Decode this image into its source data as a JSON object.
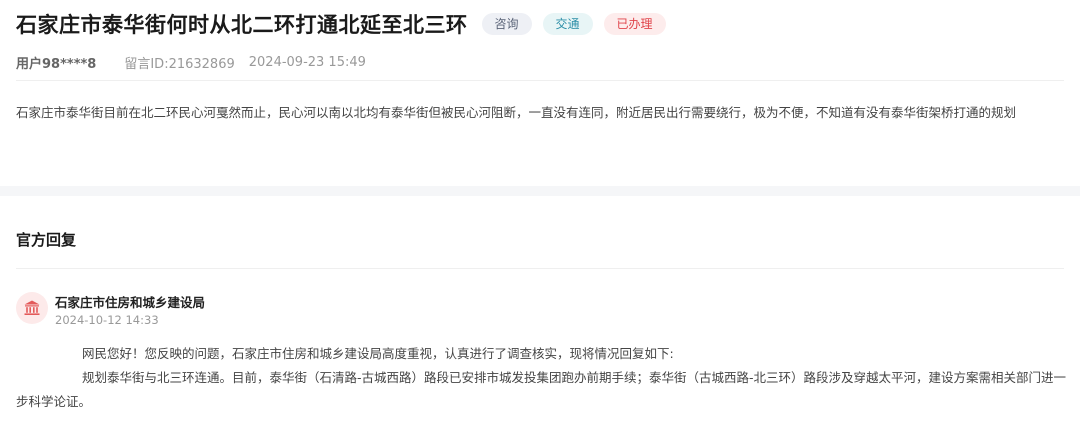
{
  "post": {
    "title": "石家庄市泰华街何时从北二环打通北延至北三环",
    "tags": [
      {
        "label": "咨询",
        "style": "gray"
      },
      {
        "label": "交通",
        "style": "teal"
      },
      {
        "label": "已办理",
        "style": "red"
      }
    ],
    "user": "用户98****8",
    "message_id": "留言ID:21632869",
    "datetime": "2024-09-23 15:49",
    "content": "石家庄市泰华街目前在北二环民心河戛然而止，民心河以南以北均有泰华街但被民心河阻断，一直没有连同，附近居民出行需要绕行，极为不便，不知道有没有泰华街架桥打通的规划"
  },
  "reply": {
    "heading": "官方回复",
    "department": "石家庄市住房和城乡建设局",
    "datetime": "2024-10-12 14:33",
    "avatar_icon": "government-building-icon",
    "paragraphs": [
      "网民您好！您反映的问题，石家庄市住房和城乡建设局高度重视，认真进行了调查核实，现将情况回复如下:",
      "规划泰华街与北三环连通。目前，泰华街（石清路-古城西路）路段已安排市城发投集团跑办前期手续；泰华街（古城西路-北三环）路段涉及穿越太平河，建设方案需相关部门进一步科学论证。"
    ]
  },
  "colors": {
    "title": "#1a1a1a",
    "tag_gray_bg": "#eef0f5",
    "tag_teal_bg": "#e8f5f6",
    "tag_red_bg": "#fdecec",
    "tag_red_text": "#e0454b",
    "avatar_bg": "#fdeaea",
    "avatar_icon": "#e35a5a",
    "section_gap": "#f5f6f8"
  }
}
